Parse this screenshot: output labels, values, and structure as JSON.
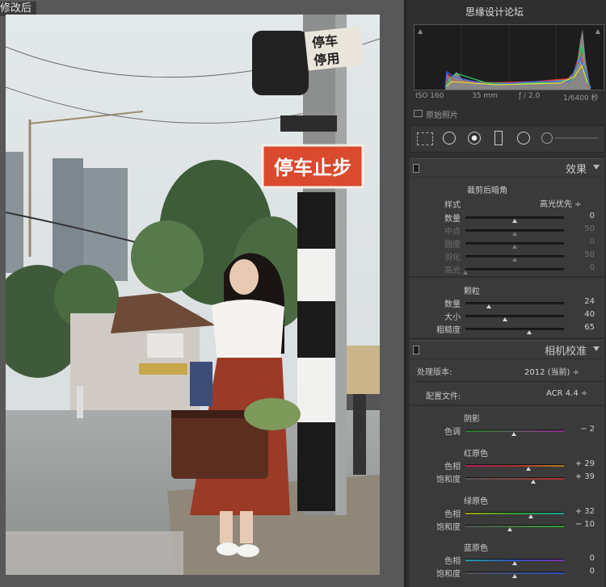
{
  "view_label": "修改后",
  "topbar_watermark": "思缘设计论坛",
  "photo_signs": {
    "big_sign": "停车止步",
    "small_sign_line1": "停车",
    "small_sign_line2": "停用"
  },
  "histogram": {
    "iso": "ISO 160",
    "focal": "35 mm",
    "aperture": "ƒ / 2.0",
    "shutter": "1/6400 秒",
    "original_photo_label": "原始照片"
  },
  "effects": {
    "title": "效果",
    "vignette_title": "裁剪后暗角",
    "style_label": "样式",
    "style_value": "高光优先 ÷",
    "sliders": [
      {
        "label": "数量",
        "value": "0",
        "pos": 0.5,
        "dim": false
      },
      {
        "label": "中点",
        "value": "50",
        "pos": 0.5,
        "dim": true
      },
      {
        "label": "圆度",
        "value": "0",
        "pos": 0.5,
        "dim": true
      },
      {
        "label": "羽化",
        "value": "50",
        "pos": 0.5,
        "dim": true
      },
      {
        "label": "高光",
        "value": "0",
        "pos": 0.0,
        "dim": true
      }
    ],
    "grain_title": "颗粒",
    "grain": [
      {
        "label": "数量",
        "value": "24",
        "pos": 0.24
      },
      {
        "label": "大小",
        "value": "40",
        "pos": 0.4
      },
      {
        "label": "粗糙度",
        "value": "65",
        "pos": 0.65
      }
    ]
  },
  "camera": {
    "title": "相机校准",
    "process_label": "处理版本:",
    "process_value": "2012 (当前) ÷",
    "profile_label": "配置文件:",
    "profile_value": "ACR 4.4 ÷",
    "shadows_title": "阴影",
    "shadows": [
      {
        "label": "色调",
        "value": "− 2",
        "pos": 0.49
      }
    ],
    "red_title": "红原色",
    "red": [
      {
        "label": "色相",
        "value": "+ 29",
        "pos": 0.64
      },
      {
        "label": "饱和度",
        "value": "+ 39",
        "pos": 0.69
      }
    ],
    "green_title": "绿原色",
    "green": [
      {
        "label": "色相",
        "value": "+ 32",
        "pos": 0.66
      },
      {
        "label": "饱和度",
        "value": "− 10",
        "pos": 0.45
      }
    ],
    "blue_title": "蓝原色",
    "blue": [
      {
        "label": "色相",
        "value": "0",
        "pos": 0.5
      },
      {
        "label": "饱和度",
        "value": "0",
        "pos": 0.5
      }
    ]
  }
}
